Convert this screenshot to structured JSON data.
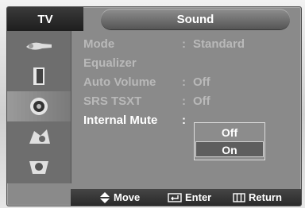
{
  "header": {
    "menu": "TV",
    "title": "Sound"
  },
  "sidebar": {
    "icons": [
      "input-icon",
      "picture-icon",
      "sound-icon",
      "channel-icon",
      "setup-icon"
    ],
    "selected_index": 2
  },
  "menu_items": [
    {
      "label": "Mode",
      "value": "Standard"
    },
    {
      "label": "Equalizer",
      "value": ""
    },
    {
      "label": "Auto Volume",
      "value": "Off"
    },
    {
      "label": "SRS TSXT",
      "value": "Off"
    },
    {
      "label": "Internal Mute",
      "value": ""
    }
  ],
  "dropdown": {
    "options": [
      "Off",
      "On"
    ],
    "selected_index": 1
  },
  "footer": {
    "move": "Move",
    "enter": "Enter",
    "return": "Return"
  },
  "colors": {
    "panel": "#8a8a8a",
    "active_text": "#ffffff",
    "dim_text": "#b9b9b9"
  }
}
